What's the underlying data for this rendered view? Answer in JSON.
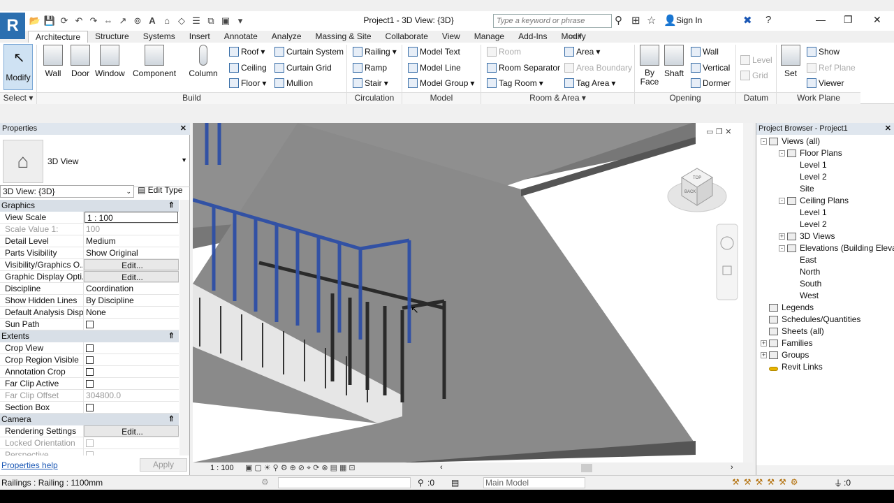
{
  "app": {
    "logo": "R",
    "doc_title": "Project1 - 3D View: {3D}"
  },
  "search": {
    "placeholder": "Type a keyword or phrase"
  },
  "signin": "Sign In",
  "tabs": [
    "Architecture",
    "Structure",
    "Systems",
    "Insert",
    "Annotate",
    "Analyze",
    "Massing & Site",
    "Collaborate",
    "View",
    "Manage",
    "Add-Ins",
    "Modify"
  ],
  "ribbon": {
    "modify": "Modify",
    "select": "Select",
    "build": {
      "wall": "Wall",
      "door": "Door",
      "window": "Window",
      "component": "Component",
      "column": "Column",
      "roof": "Roof",
      "ceiling": "Ceiling",
      "floor": "Floor",
      "curtain_system": "Curtain System",
      "curtain_grid": "Curtain Grid",
      "mullion": "Mullion",
      "label": "Build"
    },
    "circulation": {
      "railing": "Railing",
      "ramp": "Ramp",
      "stair": "Stair",
      "label": "Circulation"
    },
    "model": {
      "model_text": "Model Text",
      "model_line": "Model Line",
      "model_group": "Model Group",
      "label": "Model"
    },
    "room_area": {
      "room": "Room",
      "room_separator": "Room Separator",
      "tag_room": "Tag Room",
      "area": "Area",
      "area_boundary": "Area Boundary",
      "tag_area": "Tag Area",
      "label": "Room & Area"
    },
    "opening": {
      "by_face_1": "By",
      "by_face_2": "Face",
      "shaft": "Shaft",
      "wall": "Wall",
      "vertical": "Vertical",
      "dormer": "Dormer",
      "label": "Opening"
    },
    "datum": {
      "level": "Level",
      "grid": "Grid",
      "label": "Datum"
    },
    "work_plane": {
      "set": "Set",
      "show": "Show",
      "ref_plane": "Ref Plane",
      "viewer": "Viewer",
      "label": "Work Plane"
    }
  },
  "properties": {
    "title": "Properties",
    "type_name": "3D View",
    "filter": "3D View: {3D}",
    "edit_type": "Edit Type",
    "groups": [
      {
        "name": "Graphics",
        "rows": [
          {
            "k": "View Scale",
            "v": "1 : 100",
            "style": "box"
          },
          {
            "k": "Scale Value    1:",
            "v": "100",
            "style": "dis"
          },
          {
            "k": "Detail Level",
            "v": "Medium"
          },
          {
            "k": "Parts Visibility",
            "v": "Show Original"
          },
          {
            "k": "Visibility/Graphics O...",
            "v": "Edit...",
            "style": "btn"
          },
          {
            "k": "Graphic Display Opti...",
            "v": "Edit...",
            "style": "btn"
          },
          {
            "k": "Discipline",
            "v": "Coordination"
          },
          {
            "k": "Show Hidden Lines",
            "v": "By Discipline"
          },
          {
            "k": "Default Analysis Disp...",
            "v": "None"
          },
          {
            "k": "Sun Path",
            "v": "",
            "style": "cb"
          }
        ]
      },
      {
        "name": "Extents",
        "rows": [
          {
            "k": "Crop View",
            "v": "",
            "style": "cb"
          },
          {
            "k": "Crop Region Visible",
            "v": "",
            "style": "cb"
          },
          {
            "k": "Annotation Crop",
            "v": "",
            "style": "cb"
          },
          {
            "k": "Far Clip Active",
            "v": "",
            "style": "cb"
          },
          {
            "k": "Far Clip Offset",
            "v": "304800.0",
            "style": "dis"
          },
          {
            "k": "Section Box",
            "v": "",
            "style": "cb"
          }
        ]
      },
      {
        "name": "Camera",
        "rows": [
          {
            "k": "Rendering Settings",
            "v": "Edit...",
            "style": "btn"
          },
          {
            "k": "Locked Orientation",
            "v": "",
            "style": "discb"
          },
          {
            "k": "Perspective",
            "v": "",
            "style": "discb"
          }
        ]
      }
    ],
    "help": "Properties help",
    "apply": "Apply"
  },
  "viewcube": {
    "top": "TOP",
    "back": "BACK"
  },
  "view_scale": "1 : 100",
  "project_browser": {
    "title": "Project Browser - Project1",
    "items": [
      {
        "label": "Views (all)",
        "level": 0,
        "tog": "-"
      },
      {
        "label": "Floor Plans",
        "level": 1,
        "tog": "-"
      },
      {
        "label": "Level 1",
        "level": 2
      },
      {
        "label": "Level 2",
        "level": 2
      },
      {
        "label": "Site",
        "level": 2
      },
      {
        "label": "Ceiling Plans",
        "level": 1,
        "tog": "-"
      },
      {
        "label": "Level 1",
        "level": 2
      },
      {
        "label": "Level 2",
        "level": 2
      },
      {
        "label": "3D Views",
        "level": 1,
        "tog": "+"
      },
      {
        "label": "Elevations (Building Elevation)",
        "level": 1,
        "tog": "-"
      },
      {
        "label": "East",
        "level": 2
      },
      {
        "label": "North",
        "level": 2
      },
      {
        "label": "South",
        "level": 2
      },
      {
        "label": "West",
        "level": 2
      },
      {
        "label": "Legends",
        "level": 0,
        "icon": true
      },
      {
        "label": "Schedules/Quantities",
        "level": 0,
        "icon": true
      },
      {
        "label": "Sheets (all)",
        "level": 0,
        "icon": true
      },
      {
        "label": "Families",
        "level": 0,
        "tog": "+",
        "icon": true
      },
      {
        "label": "Groups",
        "level": 0,
        "tog": "+",
        "icon": true
      },
      {
        "label": "Revit Links",
        "level": 0,
        "link": true
      }
    ]
  },
  "status": {
    "text": "Railings : Railing : 1100mm",
    "zero": ":0",
    "model": "Main Model",
    "filter_count": ":0"
  },
  "colors": {
    "railing_selected": "#2e4fa6",
    "slab": "#8c8c8c",
    "stair": "#4a4a4a"
  }
}
